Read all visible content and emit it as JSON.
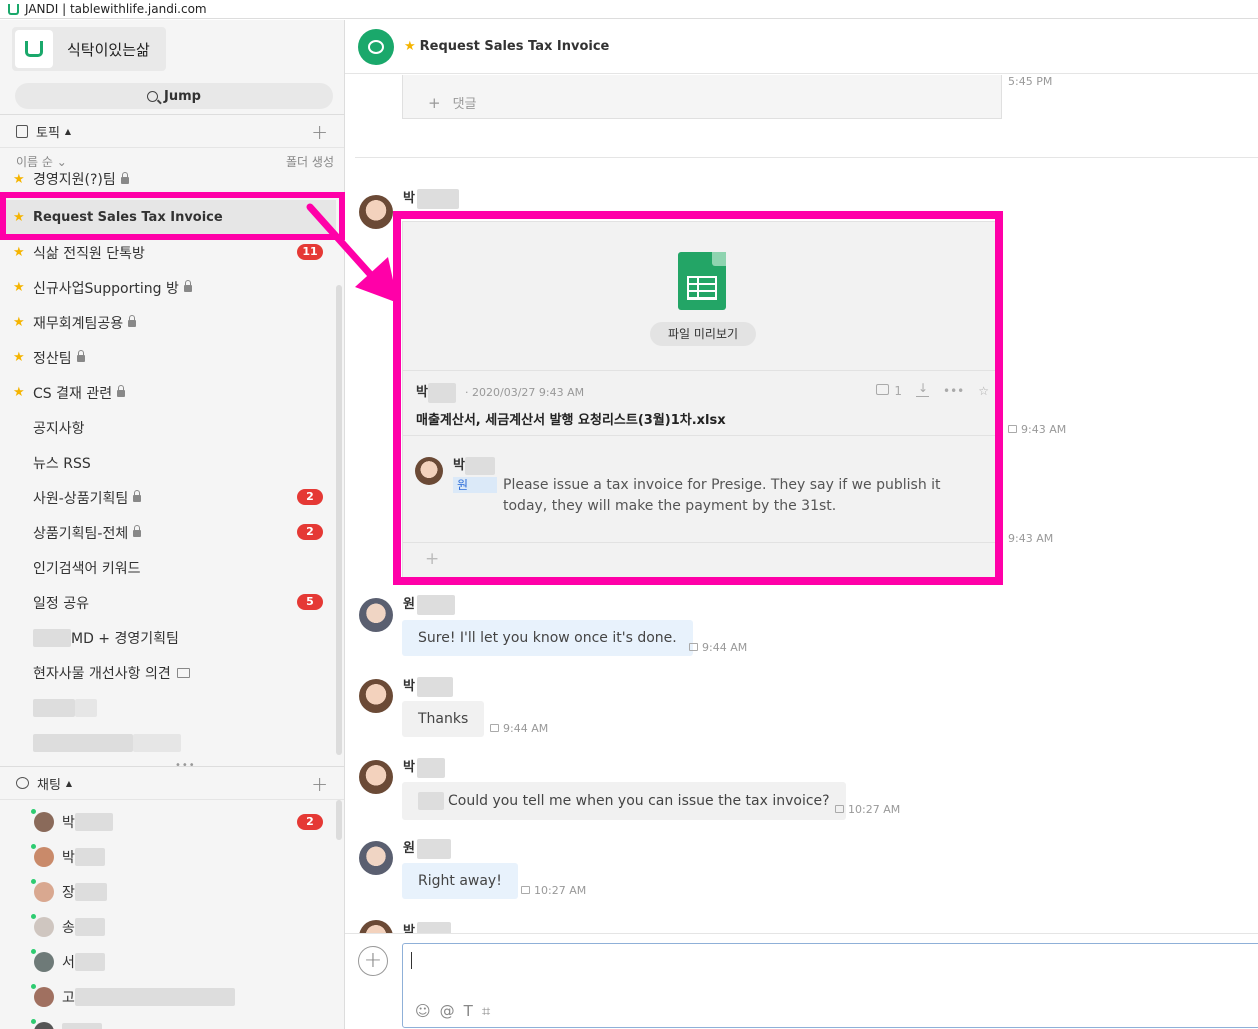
{
  "window": {
    "title": "JANDI | tablewithlife.jandi.com"
  },
  "team": {
    "name": "식탁이있는삶"
  },
  "jump": {
    "label": "Jump"
  },
  "topics": {
    "header": "토픽",
    "sort_label": "이름 순",
    "folder_label": "폴더 생성",
    "items": [
      {
        "label": "경영지원(?)팀",
        "starred": true,
        "locked": true
      },
      {
        "label": "Request Sales Tax Invoice",
        "starred": true,
        "active": true
      },
      {
        "label": "식삶 전직원 단톡방",
        "starred": true,
        "badge": "11"
      },
      {
        "label": "신규사업Supporting 방",
        "starred": true,
        "locked": true
      },
      {
        "label": "재무회계팀공용",
        "starred": true,
        "locked": true
      },
      {
        "label": "정산팀",
        "starred": true,
        "locked": true
      },
      {
        "label": "CS 결재 관련",
        "starred": true,
        "locked": true
      },
      {
        "label": "공지사항"
      },
      {
        "label": "뉴스 RSS"
      },
      {
        "label": "사원-상품기획팀",
        "locked": true,
        "badge": "2"
      },
      {
        "label": "상품기획팀-전체",
        "locked": true,
        "badge": "2"
      },
      {
        "label": "인기검색어 키워드"
      },
      {
        "label": "일정 공유",
        "badge": "5"
      },
      {
        "label": "MD + 경영기획팀"
      },
      {
        "label": "현자사물 개선사항 의견"
      }
    ]
  },
  "chats": {
    "header": "채팅",
    "items": [
      {
        "label": "박",
        "badge": "2"
      },
      {
        "label": "박"
      },
      {
        "label": "장"
      },
      {
        "label": "송"
      },
      {
        "label": "서"
      },
      {
        "label": "고"
      }
    ]
  },
  "topic_header": {
    "title": "Request Sales Tax Invoice"
  },
  "messages": {
    "prev_comment_label": "댓글",
    "prev_time": "5:45 PM",
    "file": {
      "sender": "박",
      "preview_label": "파일 미리보기",
      "uploader": "박",
      "date": "· 2020/03/27 9:43 AM",
      "filename": "매출계산서, 세금계산서 발행 요청리스트(3월)1차.xlsx",
      "comment_count": "1",
      "time": "9:43 AM",
      "comment": {
        "sender": "박",
        "mention": "원",
        "text": "Please issue a tax invoice for Presige. They say if we publish it today, they will make the payment by the 31st.",
        "time": "9:43 AM"
      }
    },
    "list": [
      {
        "sender": "원",
        "text": "Sure! I'll let you know once it's done.",
        "time": "9:44 AM"
      },
      {
        "sender": "박",
        "text": "Thanks",
        "time": "9:44 AM"
      },
      {
        "sender": "박",
        "text": "Could you tell me when you can issue the tax invoice?",
        "time": "10:27 AM"
      },
      {
        "sender": "원",
        "text": "Right away!",
        "time": "10:27 AM"
      },
      {
        "sender": "박"
      }
    ]
  },
  "colors": {
    "accent": "#1aa86b",
    "highlight": "#ff00a8",
    "badge": "#e53935",
    "star": "#f5b400"
  }
}
